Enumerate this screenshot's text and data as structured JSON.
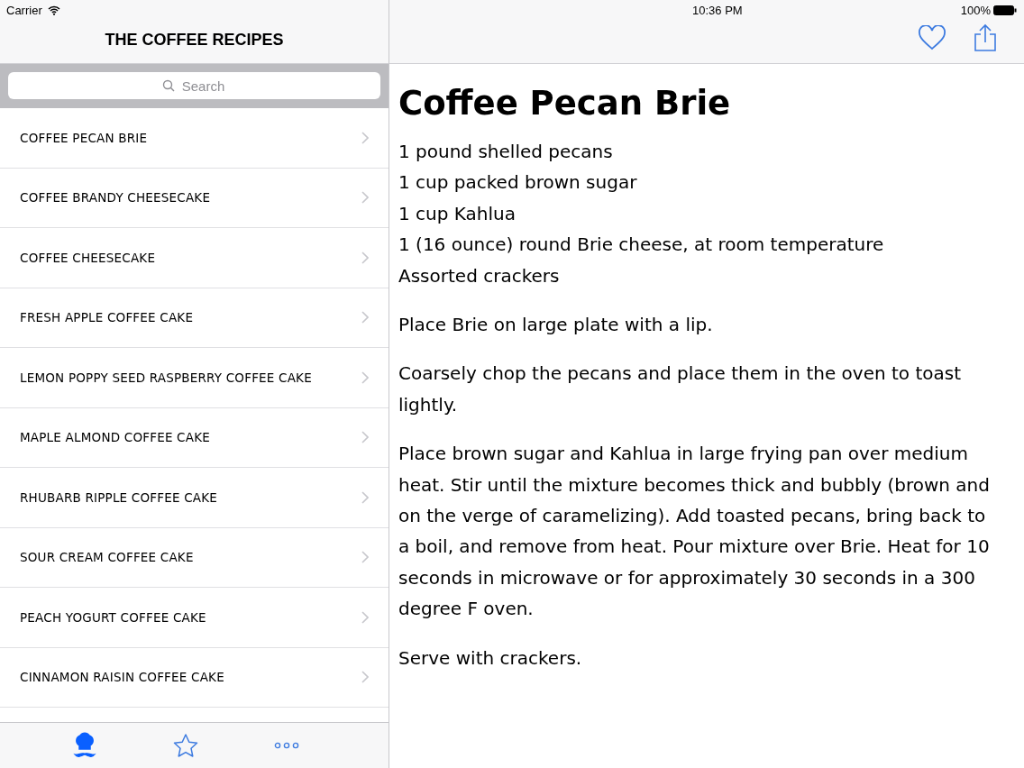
{
  "status_bar": {
    "carrier": "Carrier",
    "time": "10:36 PM",
    "battery": "100%"
  },
  "master": {
    "title": "THE COFFEE RECIPES",
    "search": {
      "placeholder": "Search"
    },
    "recipes": [
      {
        "name": "COFFEE PECAN BRIE"
      },
      {
        "name": "COFFEE BRANDY CHEESECAKE"
      },
      {
        "name": "COFFEE CHEESECAKE"
      },
      {
        "name": "FRESH APPLE COFFEE CAKE"
      },
      {
        "name": "LEMON POPPY SEED RASPBERRY COFFEE CAKE"
      },
      {
        "name": "MAPLE ALMOND COFFEE CAKE"
      },
      {
        "name": "RHUBARB RIPPLE COFFEE CAKE"
      },
      {
        "name": "SOUR CREAM COFFEE CAKE"
      },
      {
        "name": "PEACH YOGURT COFFEE CAKE"
      },
      {
        "name": "CINNAMON RAISIN COFFEE CAKE"
      }
    ],
    "tabs": [
      {
        "kind": "chef",
        "selected": true
      },
      {
        "kind": "star",
        "selected": false
      },
      {
        "kind": "more",
        "selected": false
      }
    ]
  },
  "detail": {
    "title": "Coffee Pecan Brie",
    "ingredients": [
      "1 pound shelled pecans",
      "1 cup packed brown sugar",
      "1 cup Kahlua",
      "1 (16 ounce) round Brie cheese, at room temperature",
      "Assorted crackers"
    ],
    "steps": [
      "Place Brie on large plate with a lip.",
      "Coarsely chop the pecans and place them in the oven to toast lightly.",
      "Place brown sugar and Kahlua in large frying pan over medium heat. Stir until the mixture becomes thick and bubbly (brown and on the verge of caramelizing). Add toasted pecans, bring back to a boil, and remove from heat. Pour mixture over Brie. Heat for 10 seconds in microwave or for approximately 30 seconds in a 300 degree F oven.",
      "Serve with crackers."
    ]
  }
}
